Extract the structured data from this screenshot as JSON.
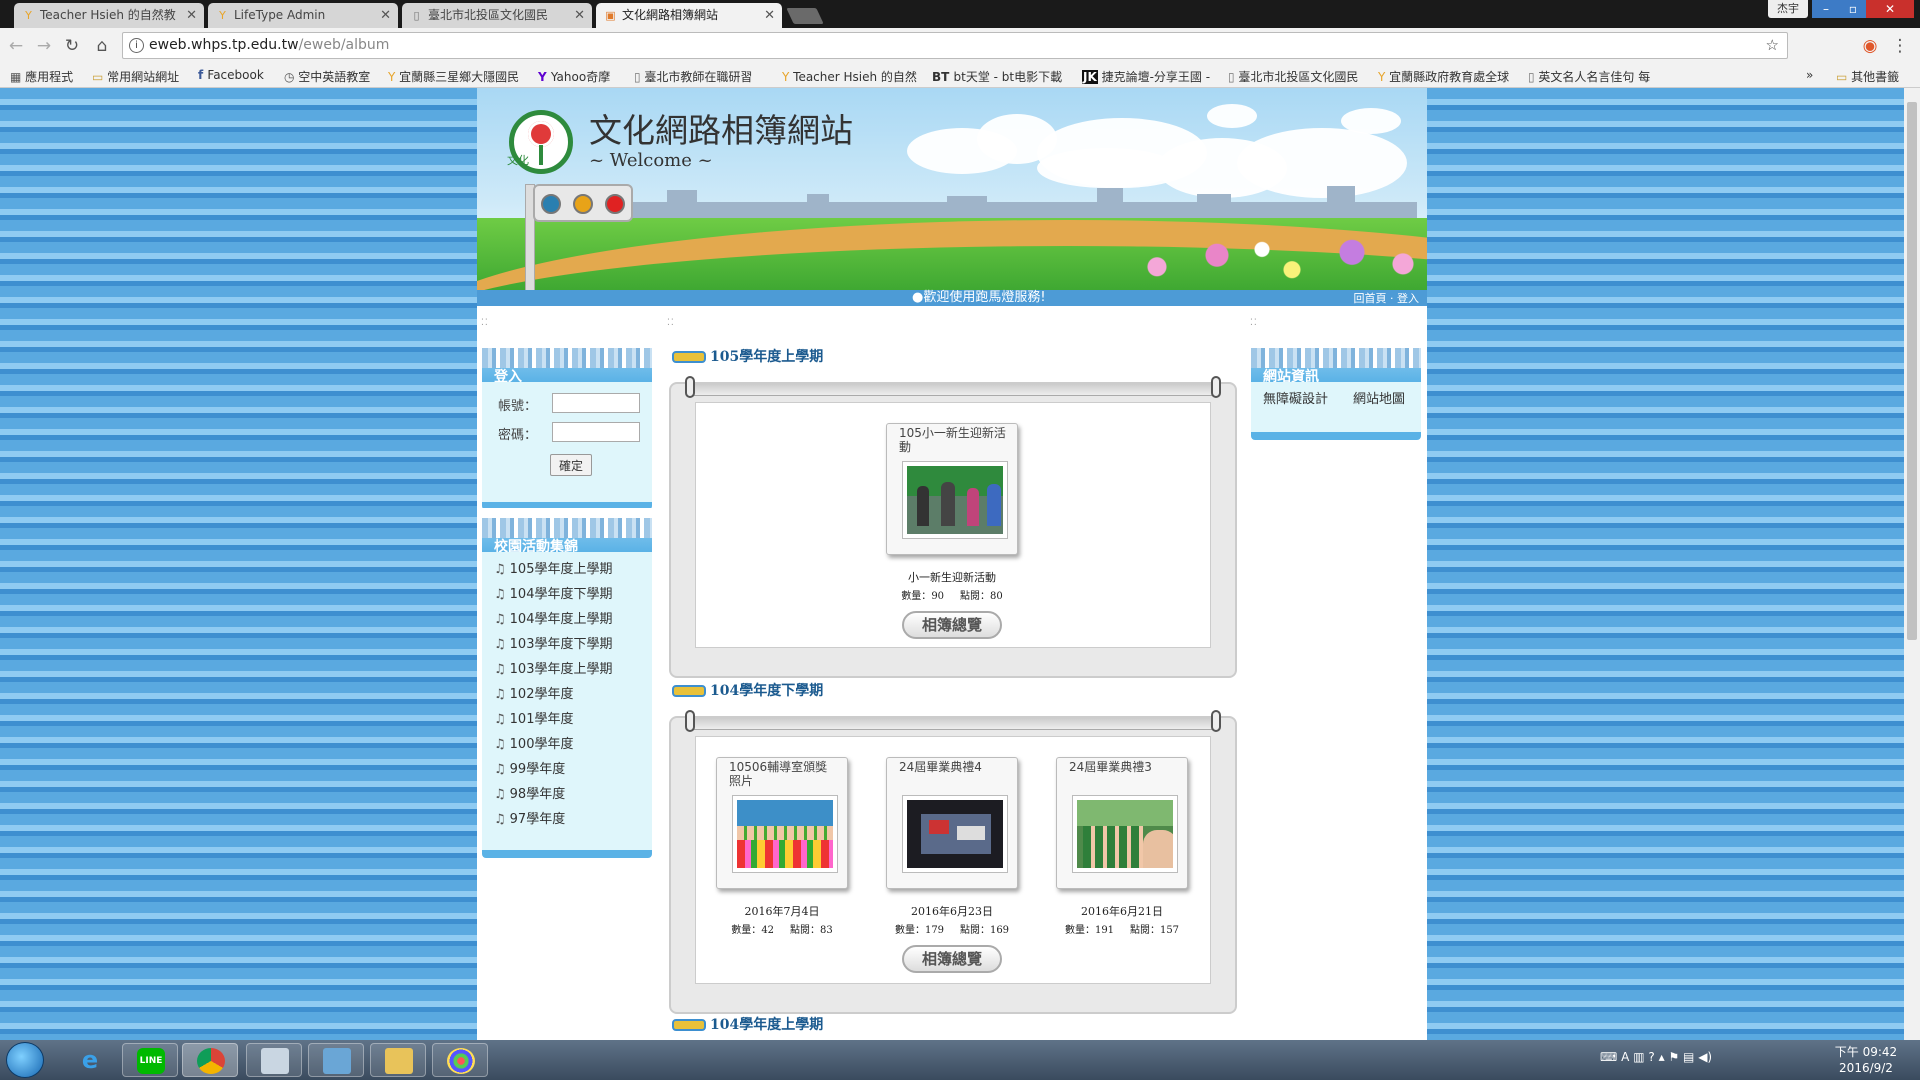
{
  "browser": {
    "tabs": [
      {
        "title": "Teacher Hsieh 的自然教",
        "icon": "tw-leaf-icon"
      },
      {
        "title": "LifeType Admin",
        "icon": "tw-leaf-icon"
      },
      {
        "title": "臺北市北投區文化國民",
        "icon": "page-icon"
      },
      {
        "title": "文化網路相簿網站",
        "icon": "image-icon"
      }
    ],
    "user_badge": "杰宇",
    "url_host": "eweb.whps.tp.edu.tw",
    "url_path": "/eweb/album",
    "bookmarks": [
      "應用程式",
      "常用網站網址",
      "Facebook",
      "空中英語教室",
      "宜蘭縣三星鄉大隱國民",
      "Yahoo奇摩",
      "臺北市教師在職研習",
      "Teacher Hsieh 的自然",
      "bt天堂 - bt电影下載",
      "捷克論壇-分享王國 -",
      "臺北市北投區文化國民",
      "宜蘭縣政府教育處全球",
      "英文名人名言佳句 每",
      "其他書籤"
    ]
  },
  "site": {
    "title": "文化網路相簿網站",
    "subtitle": "~ Welcome ~",
    "logo_text": "文化",
    "marquee": "●歡迎使用跑馬燈服務!",
    "link_home": "回首頁",
    "link_sep": "‧",
    "link_login": "登入"
  },
  "login_box": {
    "title": "登入",
    "account_label": "帳號：",
    "password_label": "密碼：",
    "account_value": "",
    "password_value": "",
    "submit_label": "確定"
  },
  "category_box": {
    "title": "校園活動集錦",
    "items": [
      "105學年度上學期",
      "104學年度下學期",
      "104學年度上學期",
      "103學年度下學期",
      "103學年度上學期",
      "102學年度",
      "101學年度",
      "100學年度",
      "99學年度",
      "98學年度",
      "97學年度"
    ]
  },
  "info_box": {
    "title": "網站資訊",
    "links": [
      "無障礙設計",
      "網站地圖"
    ]
  },
  "sections": [
    {
      "heading": "105學年度上學期",
      "overview_label": "相簿總覽",
      "albums": [
        {
          "tab": "105小一新生迎新活動",
          "date": "小一新生迎新活動",
          "count_label": "數量：",
          "count": "90",
          "views_label": "點閱：",
          "views": "80"
        }
      ]
    },
    {
      "heading": "104學年度下學期",
      "overview_label": "相簿總覽",
      "albums": [
        {
          "tab": "10506輔導室頒獎照片",
          "date": "2016年7月4日",
          "count_label": "數量：",
          "count": "42",
          "views_label": "點閱：",
          "views": "83"
        },
        {
          "tab": "24屆畢業典禮4",
          "date": "2016年6月23日",
          "count_label": "數量：",
          "count": "179",
          "views_label": "點閱：",
          "views": "169"
        },
        {
          "tab": "24屆畢業典禮3",
          "date": "2016年6月21日",
          "count_label": "數量：",
          "count": "191",
          "views_label": "點閱：",
          "views": "157"
        }
      ]
    },
    {
      "heading": "104學年度上學期"
    }
  ],
  "taskbar": {
    "clock_time": "下午 09:42",
    "clock_date": "2016/9/2"
  }
}
